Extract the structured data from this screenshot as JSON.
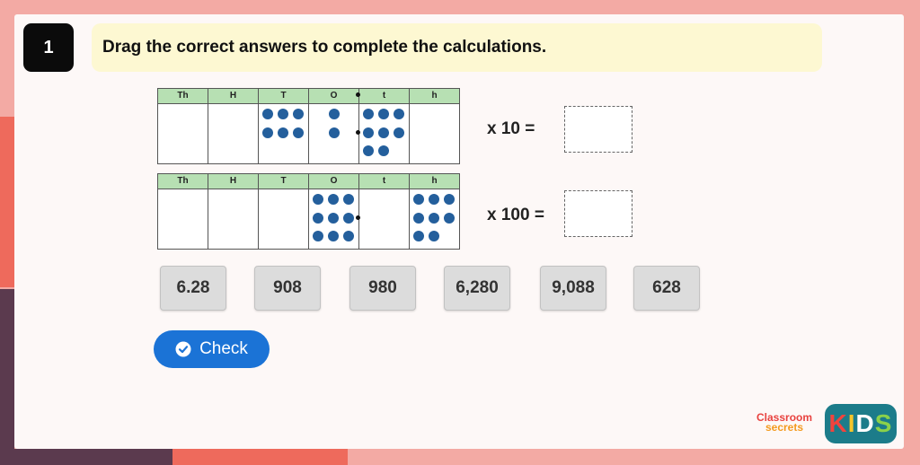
{
  "question": {
    "number": "1",
    "text": "Drag the correct answers to complete the calculations."
  },
  "charts": [
    {
      "headers": [
        "Th",
        "H",
        "T",
        "O",
        "t",
        "h"
      ],
      "counters": [
        0,
        0,
        6,
        2,
        8,
        0
      ],
      "equation": "x 10 ="
    },
    {
      "headers": [
        "Th",
        "H",
        "T",
        "O",
        "t",
        "h"
      ],
      "counters": [
        0,
        0,
        0,
        9,
        0,
        8
      ],
      "equation": "x 100 ="
    }
  ],
  "answers": [
    "6.28",
    "908",
    "980",
    "6,280",
    "9,088",
    "628"
  ],
  "check_button": {
    "label": "Check"
  },
  "branding": {
    "line1": "Classroom",
    "line2": "secrets",
    "kids": [
      "K",
      "I",
      "D",
      "S"
    ]
  },
  "colors": {
    "counter": "#245f9c",
    "header": "#b7e0b3",
    "check": "#1b73d6"
  }
}
